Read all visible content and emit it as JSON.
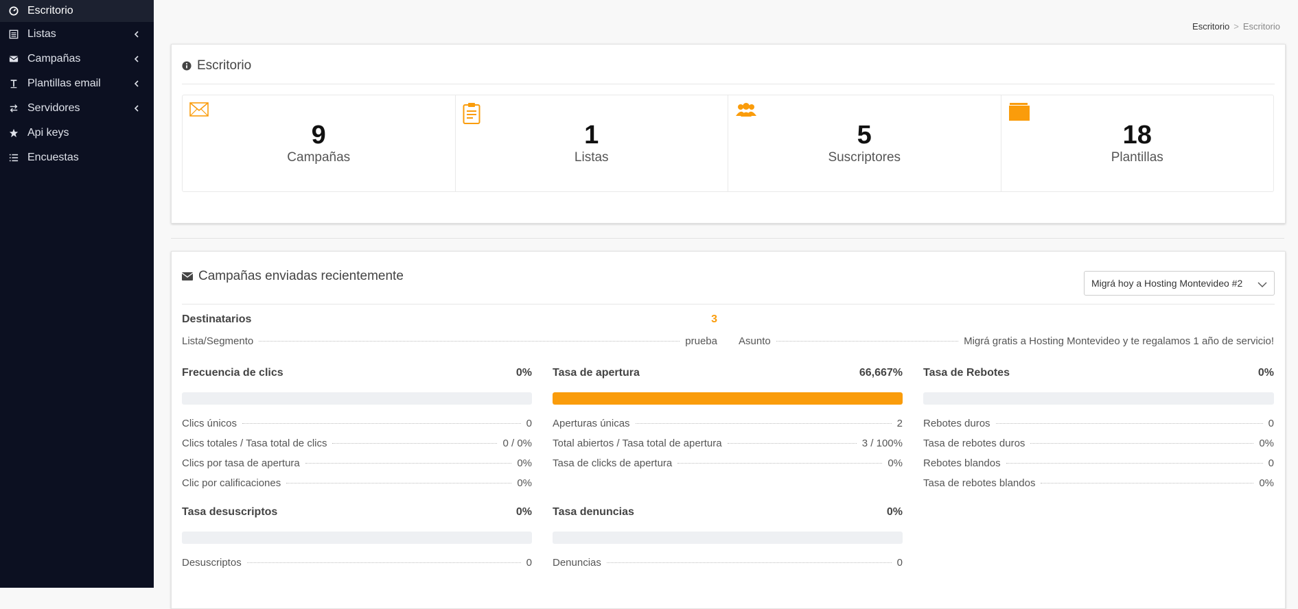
{
  "sidebar": {
    "items": [
      {
        "label": "Escritorio",
        "icon": "dashboard-icon",
        "active": true,
        "expandable": false
      },
      {
        "label": "Listas",
        "icon": "list-icon",
        "active": false,
        "expandable": true
      },
      {
        "label": "Campañas",
        "icon": "envelope-icon",
        "active": false,
        "expandable": true
      },
      {
        "label": "Plantillas email",
        "icon": "text-icon",
        "active": false,
        "expandable": true
      },
      {
        "label": "Servidores",
        "icon": "exchange-icon",
        "active": false,
        "expandable": true
      },
      {
        "label": "Api keys",
        "icon": "star-icon",
        "active": false,
        "expandable": false
      },
      {
        "label": "Encuestas",
        "icon": "list-lines-icon",
        "active": false,
        "expandable": false
      }
    ]
  },
  "breadcrumb": {
    "root": "Escritorio",
    "separator": ">",
    "current": "Escritorio"
  },
  "dashboard": {
    "title": "Escritorio",
    "stats": [
      {
        "value": "9",
        "label": "Campañas",
        "icon": "envelope-outline-icon"
      },
      {
        "value": "1",
        "label": "Listas",
        "icon": "clipboard-icon"
      },
      {
        "value": "5",
        "label": "Suscriptores",
        "icon": "users-icon"
      },
      {
        "value": "18",
        "label": "Plantillas",
        "icon": "folder-icon"
      }
    ]
  },
  "campaigns": {
    "title": "Campañas enviadas recientemente",
    "selected_campaign": "Migrá hoy a Hosting Montevideo #2",
    "recipients_label": "Destinatarios",
    "recipients_value": "3",
    "list_label": "Lista/Segmento",
    "list_value": "prueba",
    "subject_label": "Asunto",
    "subject_value": "Migrá gratis a Hosting Montevideo y te regalamos 1 año de servicio!",
    "blocks": {
      "clicks": {
        "title": "Frecuencia de clics",
        "pct": "0%",
        "fill": 0,
        "rows": [
          {
            "label": "Clics únicos",
            "value": "0"
          },
          {
            "label": "Clics totales / Tasa total de clics",
            "value": "0 / 0%"
          },
          {
            "label": "Clics por tasa de apertura",
            "value": "0%"
          },
          {
            "label": "Clic por calificaciones",
            "value": "0%"
          }
        ]
      },
      "opens": {
        "title": "Tasa de apertura",
        "pct": "66,667%",
        "fill": 1,
        "rows": [
          {
            "label": "Aperturas únicas",
            "value": "2"
          },
          {
            "label": "Total abiertos / Tasa total de apertura",
            "value": "3 / 100%"
          },
          {
            "label": "Tasa de clicks de apertura",
            "value": "0%"
          }
        ]
      },
      "bounces": {
        "title": "Tasa de Rebotes",
        "pct": "0%",
        "fill": 0,
        "rows": [
          {
            "label": "Rebotes duros",
            "value": "0"
          },
          {
            "label": "Tasa de rebotes duros",
            "value": "0%"
          },
          {
            "label": "Rebotes blandos",
            "value": "0"
          },
          {
            "label": "Tasa de rebotes blandos",
            "value": "0%"
          }
        ]
      },
      "unsubs": {
        "title": "Tasa desuscriptos",
        "pct": "0%",
        "fill": 0,
        "rows": [
          {
            "label": "Desuscriptos",
            "value": "0"
          }
        ]
      },
      "complaints": {
        "title": "Tasa denuncias",
        "pct": "0%",
        "fill": 0,
        "rows": [
          {
            "label": "Denuncias",
            "value": "0"
          }
        ]
      }
    }
  },
  "colors": {
    "accent": "#fa9c0b",
    "sidebar_bg": "#0c1021",
    "sidebar_active": "#1c2130"
  }
}
